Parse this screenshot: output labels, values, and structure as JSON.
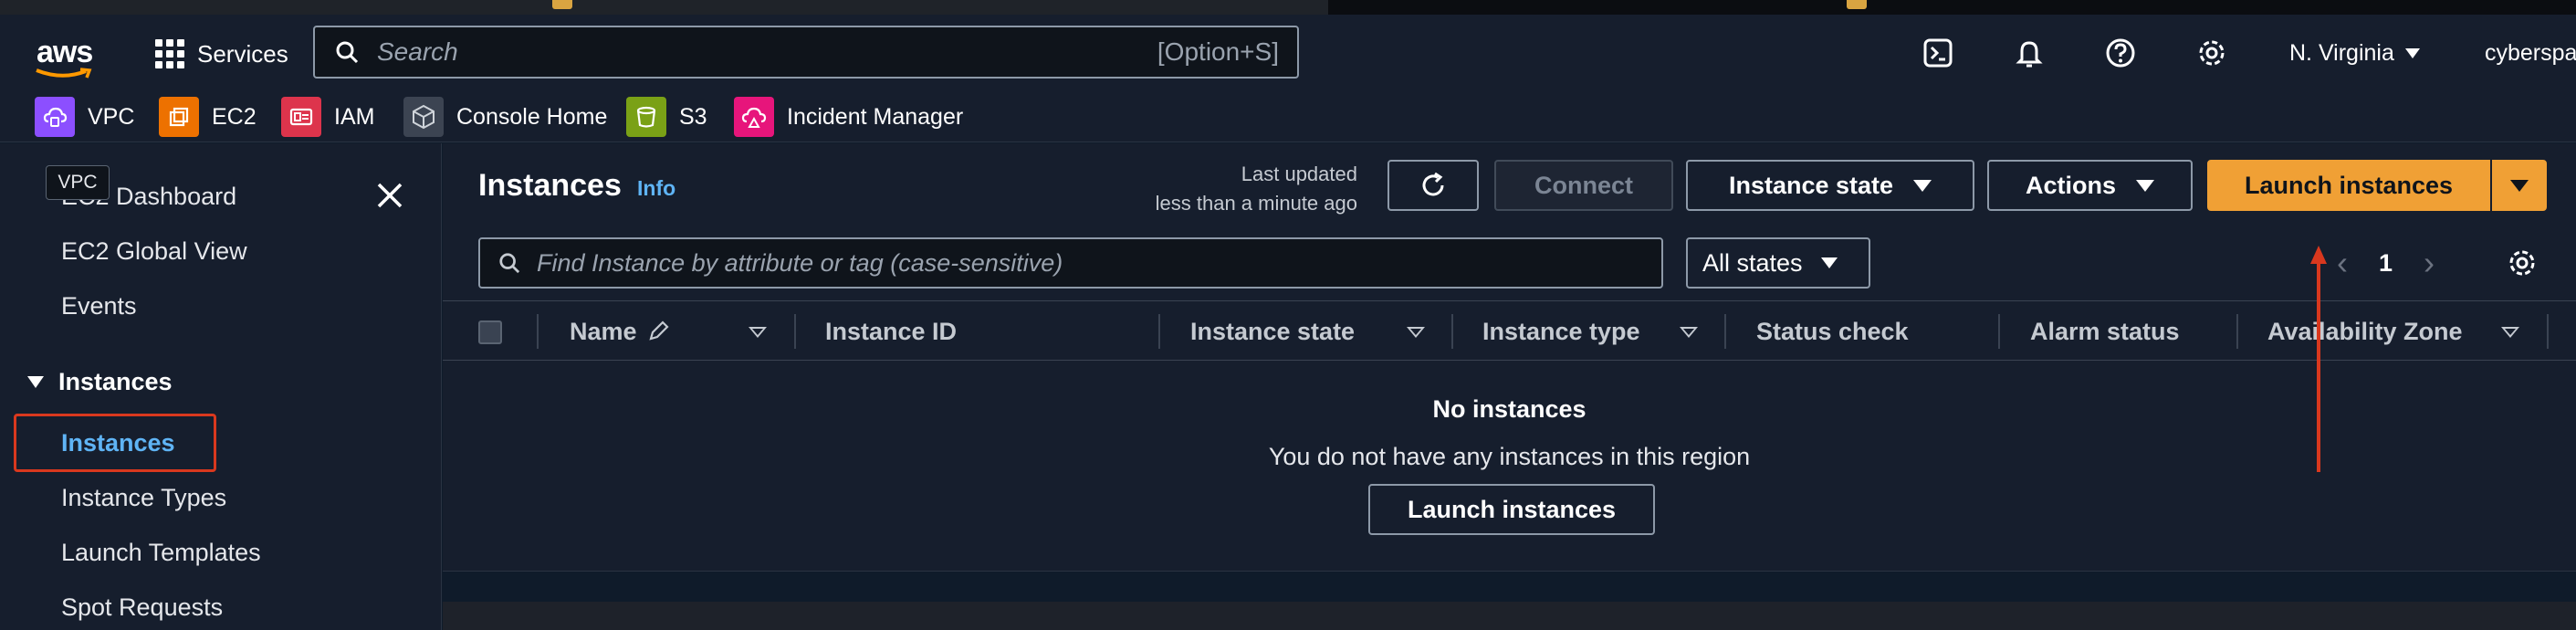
{
  "nav": {
    "logo_text": "aws",
    "services_label": "Services",
    "search_placeholder": "Search",
    "search_shortcut": "[Option+S]",
    "region": "N. Virginia",
    "account": "cyberspa"
  },
  "favorites": [
    {
      "label": "VPC",
      "icon": "vpc-icon",
      "color": "#8c4fff"
    },
    {
      "label": "EC2",
      "icon": "ec2-icon",
      "color": "#ed7100"
    },
    {
      "label": "IAM",
      "icon": "iam-icon",
      "color": "#dd344c"
    },
    {
      "label": "Console Home",
      "icon": "console-home-icon",
      "color": "#3c4452"
    },
    {
      "label": "S3",
      "icon": "s3-icon",
      "color": "#7aa116"
    },
    {
      "label": "Incident Manager",
      "icon": "incident-manager-icon",
      "color": "#e7157b"
    }
  ],
  "sidebar": {
    "tooltip": "VPC",
    "items": [
      "EC2 Dashboard",
      "EC2 Global View",
      "Events"
    ],
    "section": "Instances",
    "section_items": [
      "Instances",
      "Instance Types",
      "Launch Templates",
      "Spot Requests"
    ],
    "active_item": "Instances"
  },
  "main": {
    "title": "Instances",
    "info_link": "Info",
    "last_updated_label": "Last updated",
    "last_updated_value": "less than a minute ago",
    "connect_label": "Connect",
    "instance_state_label": "Instance state",
    "actions_label": "Actions",
    "launch_label": "Launch instances",
    "filter_placeholder": "Find Instance by attribute or tag (case-sensitive)",
    "states_filter": "All states",
    "page_number": "1",
    "columns": [
      "Name",
      "Instance ID",
      "Instance state",
      "Instance type",
      "Status check",
      "Alarm status",
      "Availability Zone"
    ],
    "empty_title": "No instances",
    "empty_subtitle": "You do not have any instances in this region",
    "empty_button": "Launch instances"
  },
  "colors": {
    "accent_orange": "#f0a035",
    "link_blue": "#5fb4f5",
    "highlight_red": "#d9381e"
  }
}
